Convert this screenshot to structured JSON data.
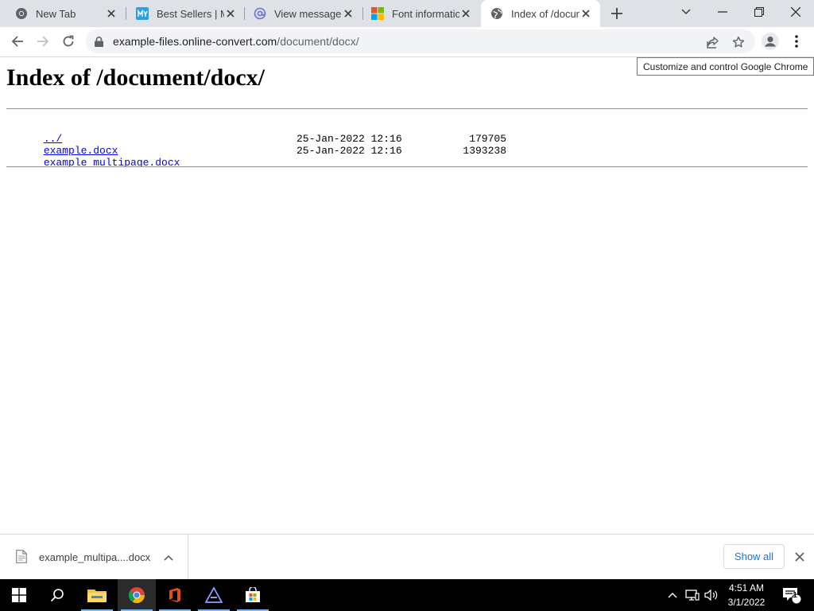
{
  "browser": {
    "tabs": [
      {
        "title": "New Tab",
        "icon": "chrome-icon"
      },
      {
        "title": "Best Sellers | My",
        "icon": "my-app-icon"
      },
      {
        "title": "View message -",
        "icon": "at-sign-icon"
      },
      {
        "title": "Font informatio",
        "icon": "microsoft-icon"
      },
      {
        "title": "Index of /docum",
        "icon": "globe-icon",
        "active": true
      }
    ],
    "address_host": "example-files.online-convert.com",
    "address_path": "/document/docx/",
    "tooltip": "Customize and control Google Chrome"
  },
  "page": {
    "title": "Index of /document/docx/",
    "entries": [
      {
        "name": "../",
        "date": "",
        "size": ""
      },
      {
        "name": "example.docx",
        "date": "25-Jan-2022 12:16",
        "size": "179705"
      },
      {
        "name": "example_multipage.docx",
        "date": "25-Jan-2022 12:16",
        "size": "1393238"
      }
    ]
  },
  "downloads": {
    "item_name": "example_multipa....docx",
    "show_all_label": "Show all"
  },
  "taskbar": {
    "time": "4:51 AM",
    "date": "3/1/2022",
    "notification_count": "1"
  },
  "colors": {
    "tabstrip": "#dee1e6",
    "link": "#0000ee",
    "accent": "#1a73e8",
    "taskbar": "#000000"
  }
}
